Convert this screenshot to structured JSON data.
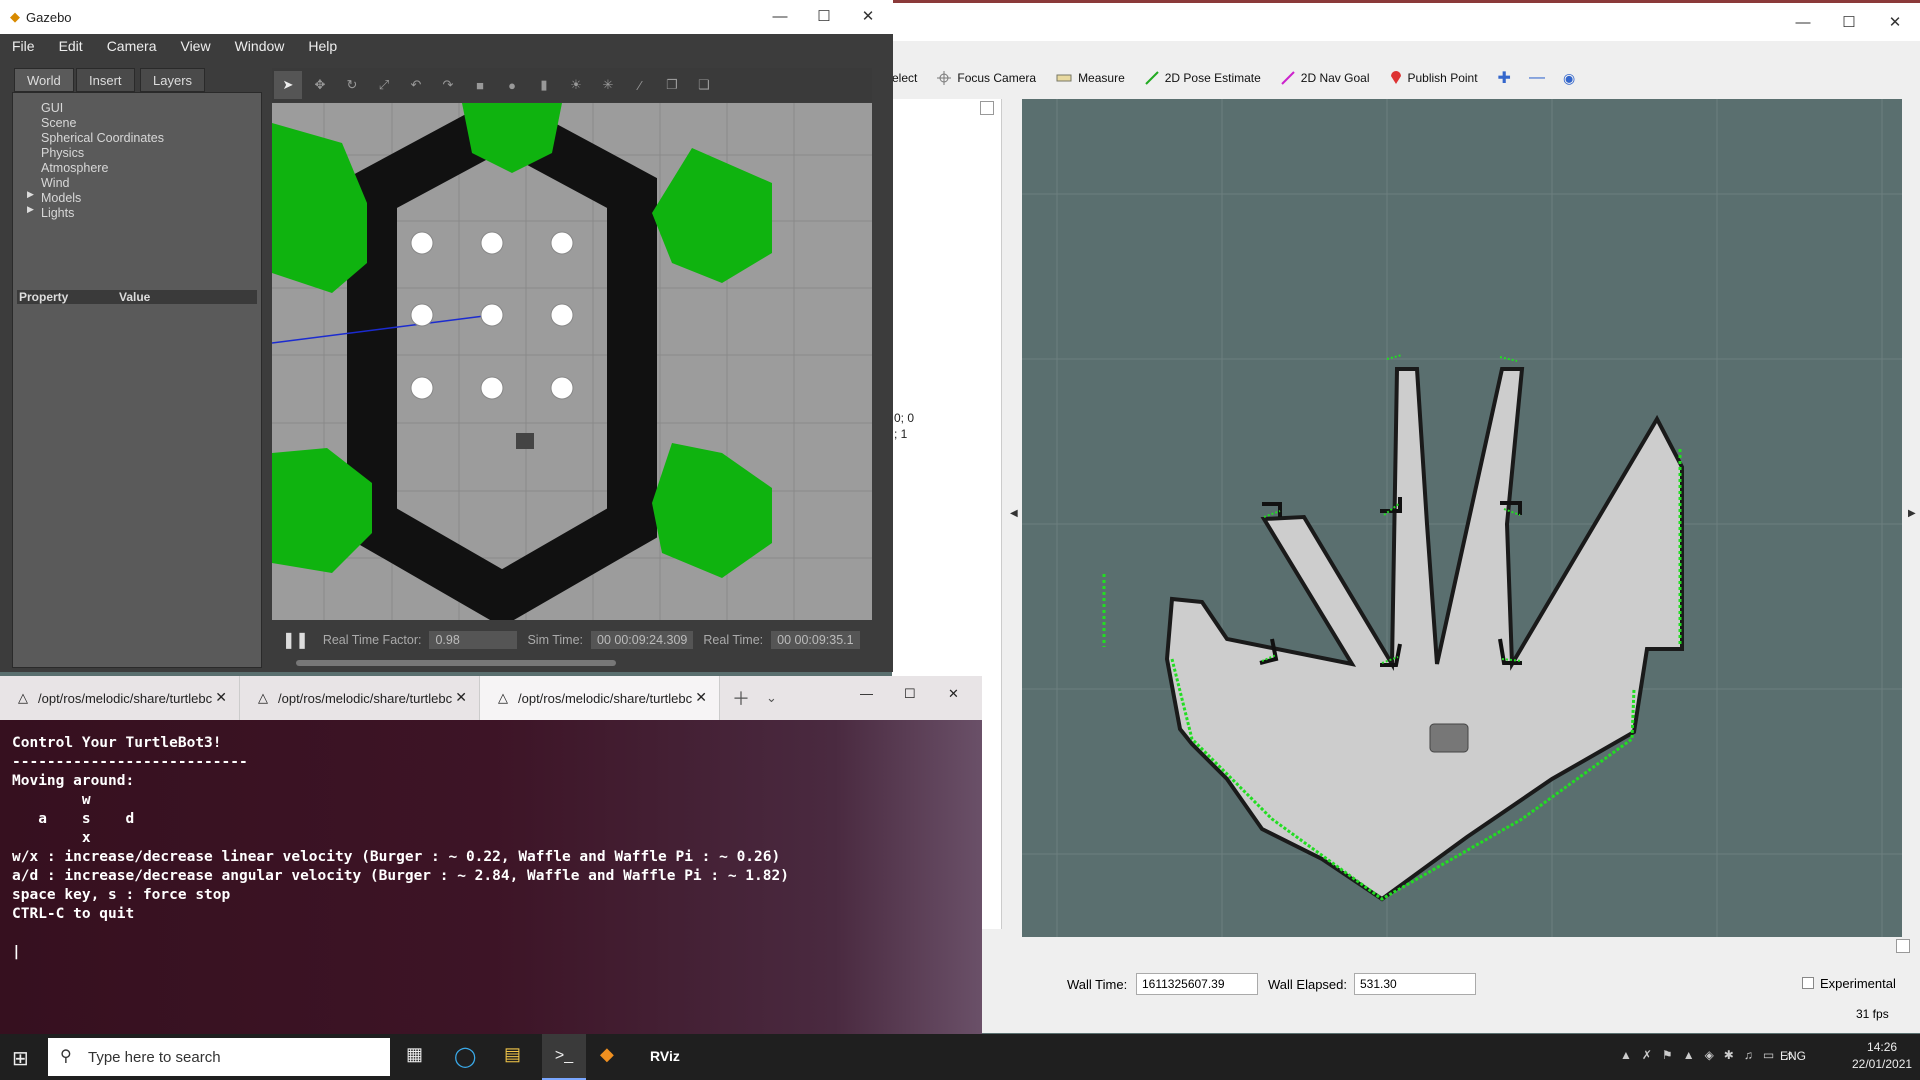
{
  "rviz": {
    "toolbar": [
      {
        "label": "elect",
        "icon": "select-icon"
      },
      {
        "label": "Focus Camera",
        "icon": "focus-camera-icon"
      },
      {
        "label": "Measure",
        "icon": "measure-icon"
      },
      {
        "label": "2D Pose Estimate",
        "icon": "pose-estimate-icon"
      },
      {
        "label": "2D Nav Goal",
        "icon": "nav-goal-icon"
      },
      {
        "label": "Publish Point",
        "icon": "publish-point-icon"
      }
    ],
    "left_text_1": "0; 0",
    "left_text_2": "; 1",
    "wall_time_label": "Wall Time:",
    "wall_time_value": "1611325607.39",
    "wall_elapsed_label": "Wall Elapsed:",
    "wall_elapsed_value": "531.30",
    "experimental_label": "Experimental",
    "fps": "31 fps"
  },
  "gazebo": {
    "title": "Gazebo",
    "menu": [
      "File",
      "Edit",
      "Camera",
      "View",
      "Window",
      "Help"
    ],
    "tabs": [
      "World",
      "Insert",
      "Layers"
    ],
    "tree": [
      "GUI",
      "Scene",
      "Spherical Coordinates",
      "Physics",
      "Atmosphere",
      "Wind",
      "Models",
      "Lights"
    ],
    "property_header": "Property",
    "value_header": "Value",
    "real_time_factor_label": "Real Time Factor:",
    "real_time_factor": "0.98",
    "sim_time_label": "Sim Time:",
    "sim_time": "00 00:09:24.309",
    "real_time_label": "Real Time:",
    "real_time": "00 00:09:35.1"
  },
  "terminal": {
    "tabs": [
      "/opt/ros/melodic/share/turtlebc",
      "/opt/ros/melodic/share/turtlebc",
      "/opt/ros/melodic/share/turtlebc"
    ],
    "lines": [
      "Control Your TurtleBot3!",
      "---------------------------",
      "Moving around:",
      "        w",
      "   a    s    d",
      "        x",
      "",
      "w/x : increase/decrease linear velocity (Burger : ~ 0.22, Waffle and Waffle Pi : ~ 0.26)",
      "a/d : increase/decrease angular velocity (Burger : ~ 2.84, Waffle and Waffle Pi : ~ 1.82)",
      "",
      "space key, s : force stop",
      "",
      "CTRL-C to quit"
    ]
  },
  "taskbar": {
    "search_placeholder": "Type here to search",
    "apps": [
      "task-view-icon",
      "edge-icon",
      "file-explorer-icon",
      "terminal-icon",
      "gazebo-icon",
      "rviz-icon"
    ],
    "rviz_label": "RViz",
    "language": "ENG",
    "time": "14:26",
    "date": "22/01/2021"
  }
}
